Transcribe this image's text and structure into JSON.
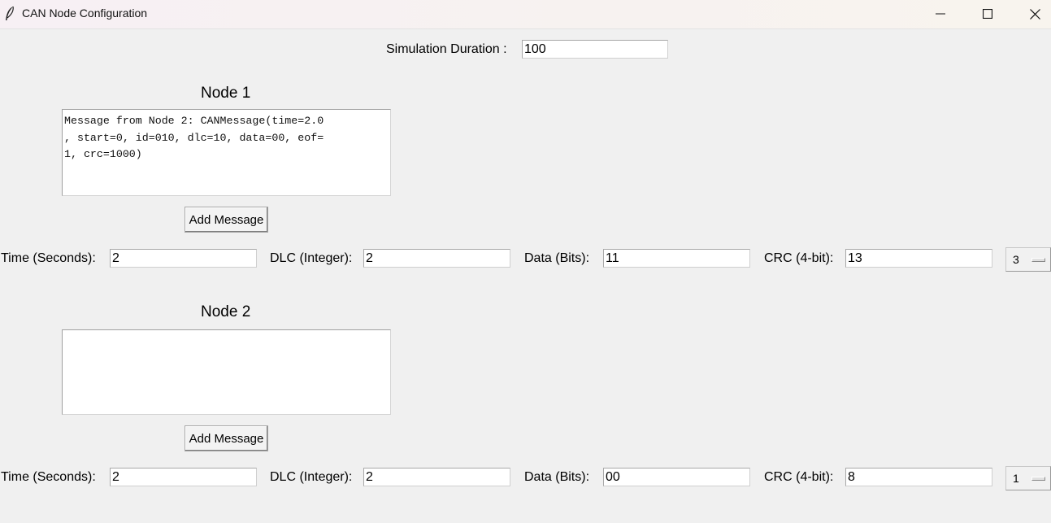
{
  "window": {
    "title": "CAN Node Configuration",
    "icon": "feather-icon",
    "controls": [
      "minimize-icon",
      "maximize-icon",
      "close-icon"
    ]
  },
  "simulation": {
    "duration_label": "Simulation Duration :",
    "duration_value": "100"
  },
  "nodes": [
    {
      "title": "Node 1",
      "log_text": "Message from Node 2: CANMessage(time=2.0\n, start=0, id=010, dlc=10, data=00, eof=\n1, crc=1000)",
      "add_button": "Add Message",
      "fields": {
        "time_label": "Time (Seconds):",
        "time_value": "2",
        "dlc_label": "DLC (Integer):",
        "dlc_value": "2",
        "data_label": "Data (Bits):",
        "data_value": "11",
        "crc_label": "CRC (4-bit):",
        "crc_value": "13",
        "option_value": "3"
      }
    },
    {
      "title": "Node 2",
      "log_text": "",
      "add_button": "Add Message",
      "fields": {
        "time_label": "Time (Seconds):",
        "time_value": "2",
        "dlc_label": "DLC (Integer):",
        "dlc_value": "2",
        "data_label": "Data (Bits):",
        "data_value": "00",
        "crc_label": "CRC (4-bit):",
        "crc_value": "8",
        "option_value": "1"
      }
    }
  ]
}
